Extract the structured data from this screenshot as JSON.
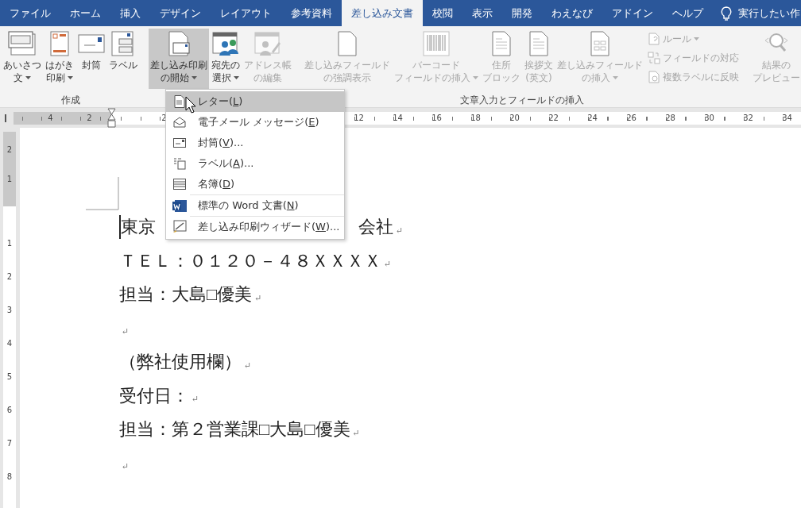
{
  "tabs": [
    {
      "label": "ファイル",
      "selected": false
    },
    {
      "label": "ホーム",
      "selected": false
    },
    {
      "label": "挿入",
      "selected": false
    },
    {
      "label": "デザイン",
      "selected": false
    },
    {
      "label": "レイアウト",
      "selected": false
    },
    {
      "label": "参考資料",
      "selected": false
    },
    {
      "label": "差し込み文書",
      "selected": true
    },
    {
      "label": "校閲",
      "selected": false
    },
    {
      "label": "表示",
      "selected": false
    },
    {
      "label": "開発",
      "selected": false
    },
    {
      "label": "わえなび",
      "selected": false
    },
    {
      "label": "アドイン",
      "selected": false
    },
    {
      "label": "ヘルプ",
      "selected": false
    }
  ],
  "tell_me": {
    "text": "実行したい作"
  },
  "ribbon": {
    "groups": [
      {
        "label": "作成",
        "buttons": [
          {
            "lines": [
              "あいさつ",
              "文"
            ],
            "dropdown": true,
            "disabled": false,
            "pressed": false
          },
          {
            "lines": [
              "はがき",
              "印刷"
            ],
            "dropdown": true,
            "disabled": false,
            "pressed": false
          },
          {
            "lines": [
              "封筒"
            ],
            "dropdown": false,
            "disabled": false,
            "pressed": false
          },
          {
            "lines": [
              "ラベル"
            ],
            "dropdown": false,
            "disabled": false,
            "pressed": false
          }
        ]
      },
      {
        "buttons": [
          {
            "lines": [
              "差し込み印刷",
              "の開始"
            ],
            "dropdown": true,
            "disabled": false,
            "pressed": true
          },
          {
            "lines": [
              "宛先の",
              "選択"
            ],
            "dropdown": true,
            "disabled": false,
            "pressed": false
          },
          {
            "lines": [
              "アドレス帳",
              "の編集"
            ],
            "dropdown": false,
            "disabled": true,
            "pressed": false
          }
        ]
      },
      {
        "label": "文章入力とフィールドの挿入",
        "buttons": [
          {
            "lines": [
              "差し込みフィールド",
              "の強調表示"
            ],
            "dropdown": false,
            "disabled": true,
            "pressed": false
          },
          {
            "lines": [
              "バーコード",
              "フィールドの挿入"
            ],
            "dropdown": true,
            "disabled": true,
            "pressed": false
          },
          {
            "lines": [
              "住所",
              "ブロック"
            ],
            "dropdown": false,
            "disabled": true,
            "pressed": false
          },
          {
            "lines": [
              "挨拶文",
              "(英文)"
            ],
            "dropdown": false,
            "disabled": true,
            "pressed": false
          },
          {
            "lines": [
              "差し込みフィールド",
              "の挿入"
            ],
            "dropdown": true,
            "disabled": true,
            "pressed": false
          }
        ],
        "small_buttons": [
          {
            "label": "ルール",
            "dropdown": true,
            "disabled": true
          },
          {
            "label": "フィールドの対応",
            "dropdown": false,
            "disabled": true
          },
          {
            "label": "複数ラベルに反映",
            "dropdown": false,
            "disabled": true
          }
        ]
      },
      {
        "buttons": [
          {
            "lines": [
              "結果の",
              "プレビュー"
            ],
            "dropdown": false,
            "disabled": true,
            "pressed": false
          }
        ]
      }
    ]
  },
  "ruler": {
    "left_numbers": [
      "4",
      "2"
    ],
    "near_numbers": [
      "2"
    ],
    "far_numbers": [
      "12",
      "14",
      "16",
      "18",
      "20",
      "22",
      "24",
      "26",
      "28",
      "30",
      "32",
      "34"
    ]
  },
  "vertical_ruler": {
    "top_numbers": [
      "2",
      "1"
    ],
    "numbers": [
      "1",
      "2",
      "3",
      "4",
      "5",
      "6",
      "7",
      "8"
    ]
  },
  "menu": {
    "items": [
      {
        "pre": "レター(",
        "key": "L",
        "post": ")",
        "selected": true,
        "divider_above": false
      },
      {
        "pre": "電子メール メッセージ(",
        "key": "E",
        "post": ")",
        "selected": false,
        "divider_above": false
      },
      {
        "pre": "封筒(",
        "key": "V",
        "post": ")...",
        "selected": false,
        "divider_above": false
      },
      {
        "pre": "ラベル(",
        "key": "A",
        "post": ")...",
        "selected": false,
        "divider_above": false
      },
      {
        "pre": "名簿(",
        "key": "D",
        "post": ")",
        "selected": false,
        "divider_above": false
      },
      {
        "pre": "標準の Word 文書(",
        "key": "N",
        "post": ")",
        "selected": false,
        "divider_above": true
      },
      {
        "pre": "差し込み印刷ウィザード(",
        "key": "W",
        "post": ")...",
        "selected": false,
        "divider_above": true
      }
    ]
  },
  "document": {
    "lines": [
      {
        "parts": [
          "東京",
          "会社"
        ],
        "mark": "↵"
      },
      {
        "parts": [
          "ＴＥＬ：０１２０－４８ＸＸＸＸ"
        ],
        "mark": "↵"
      },
      {
        "parts": [
          "担当：大島□優美"
        ],
        "mark": "↵"
      },
      {
        "mark": "↵"
      },
      {
        "parts": [
          "（弊社使用欄）"
        ],
        "mark": "↵"
      },
      {
        "parts": [
          "受付日："
        ],
        "mark": "↵"
      },
      {
        "parts": [
          "担当：第２営業課□大島□優美"
        ],
        "mark": "↵"
      },
      {
        "mark": "↵"
      }
    ]
  }
}
